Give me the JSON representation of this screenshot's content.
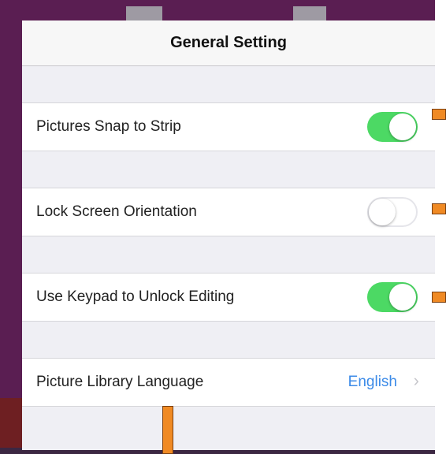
{
  "header": {
    "title": "General Setting"
  },
  "settings": [
    {
      "label": "Pictures Snap to Strip",
      "type": "toggle",
      "enabled": true
    },
    {
      "label": "Lock Screen Orientation",
      "type": "toggle",
      "enabled": false
    },
    {
      "label": "Use Keypad to Unlock Editing",
      "type": "toggle",
      "enabled": true
    },
    {
      "label": "Picture Library Language",
      "type": "disclosure",
      "value": "English"
    }
  ],
  "colors": {
    "toggle_on": "#4cd964",
    "value_text": "#3c8be8",
    "background": "#5a1e52",
    "callout_marker": "#f08a24"
  },
  "icons": {
    "disclosure": "chevron-right-icon"
  }
}
